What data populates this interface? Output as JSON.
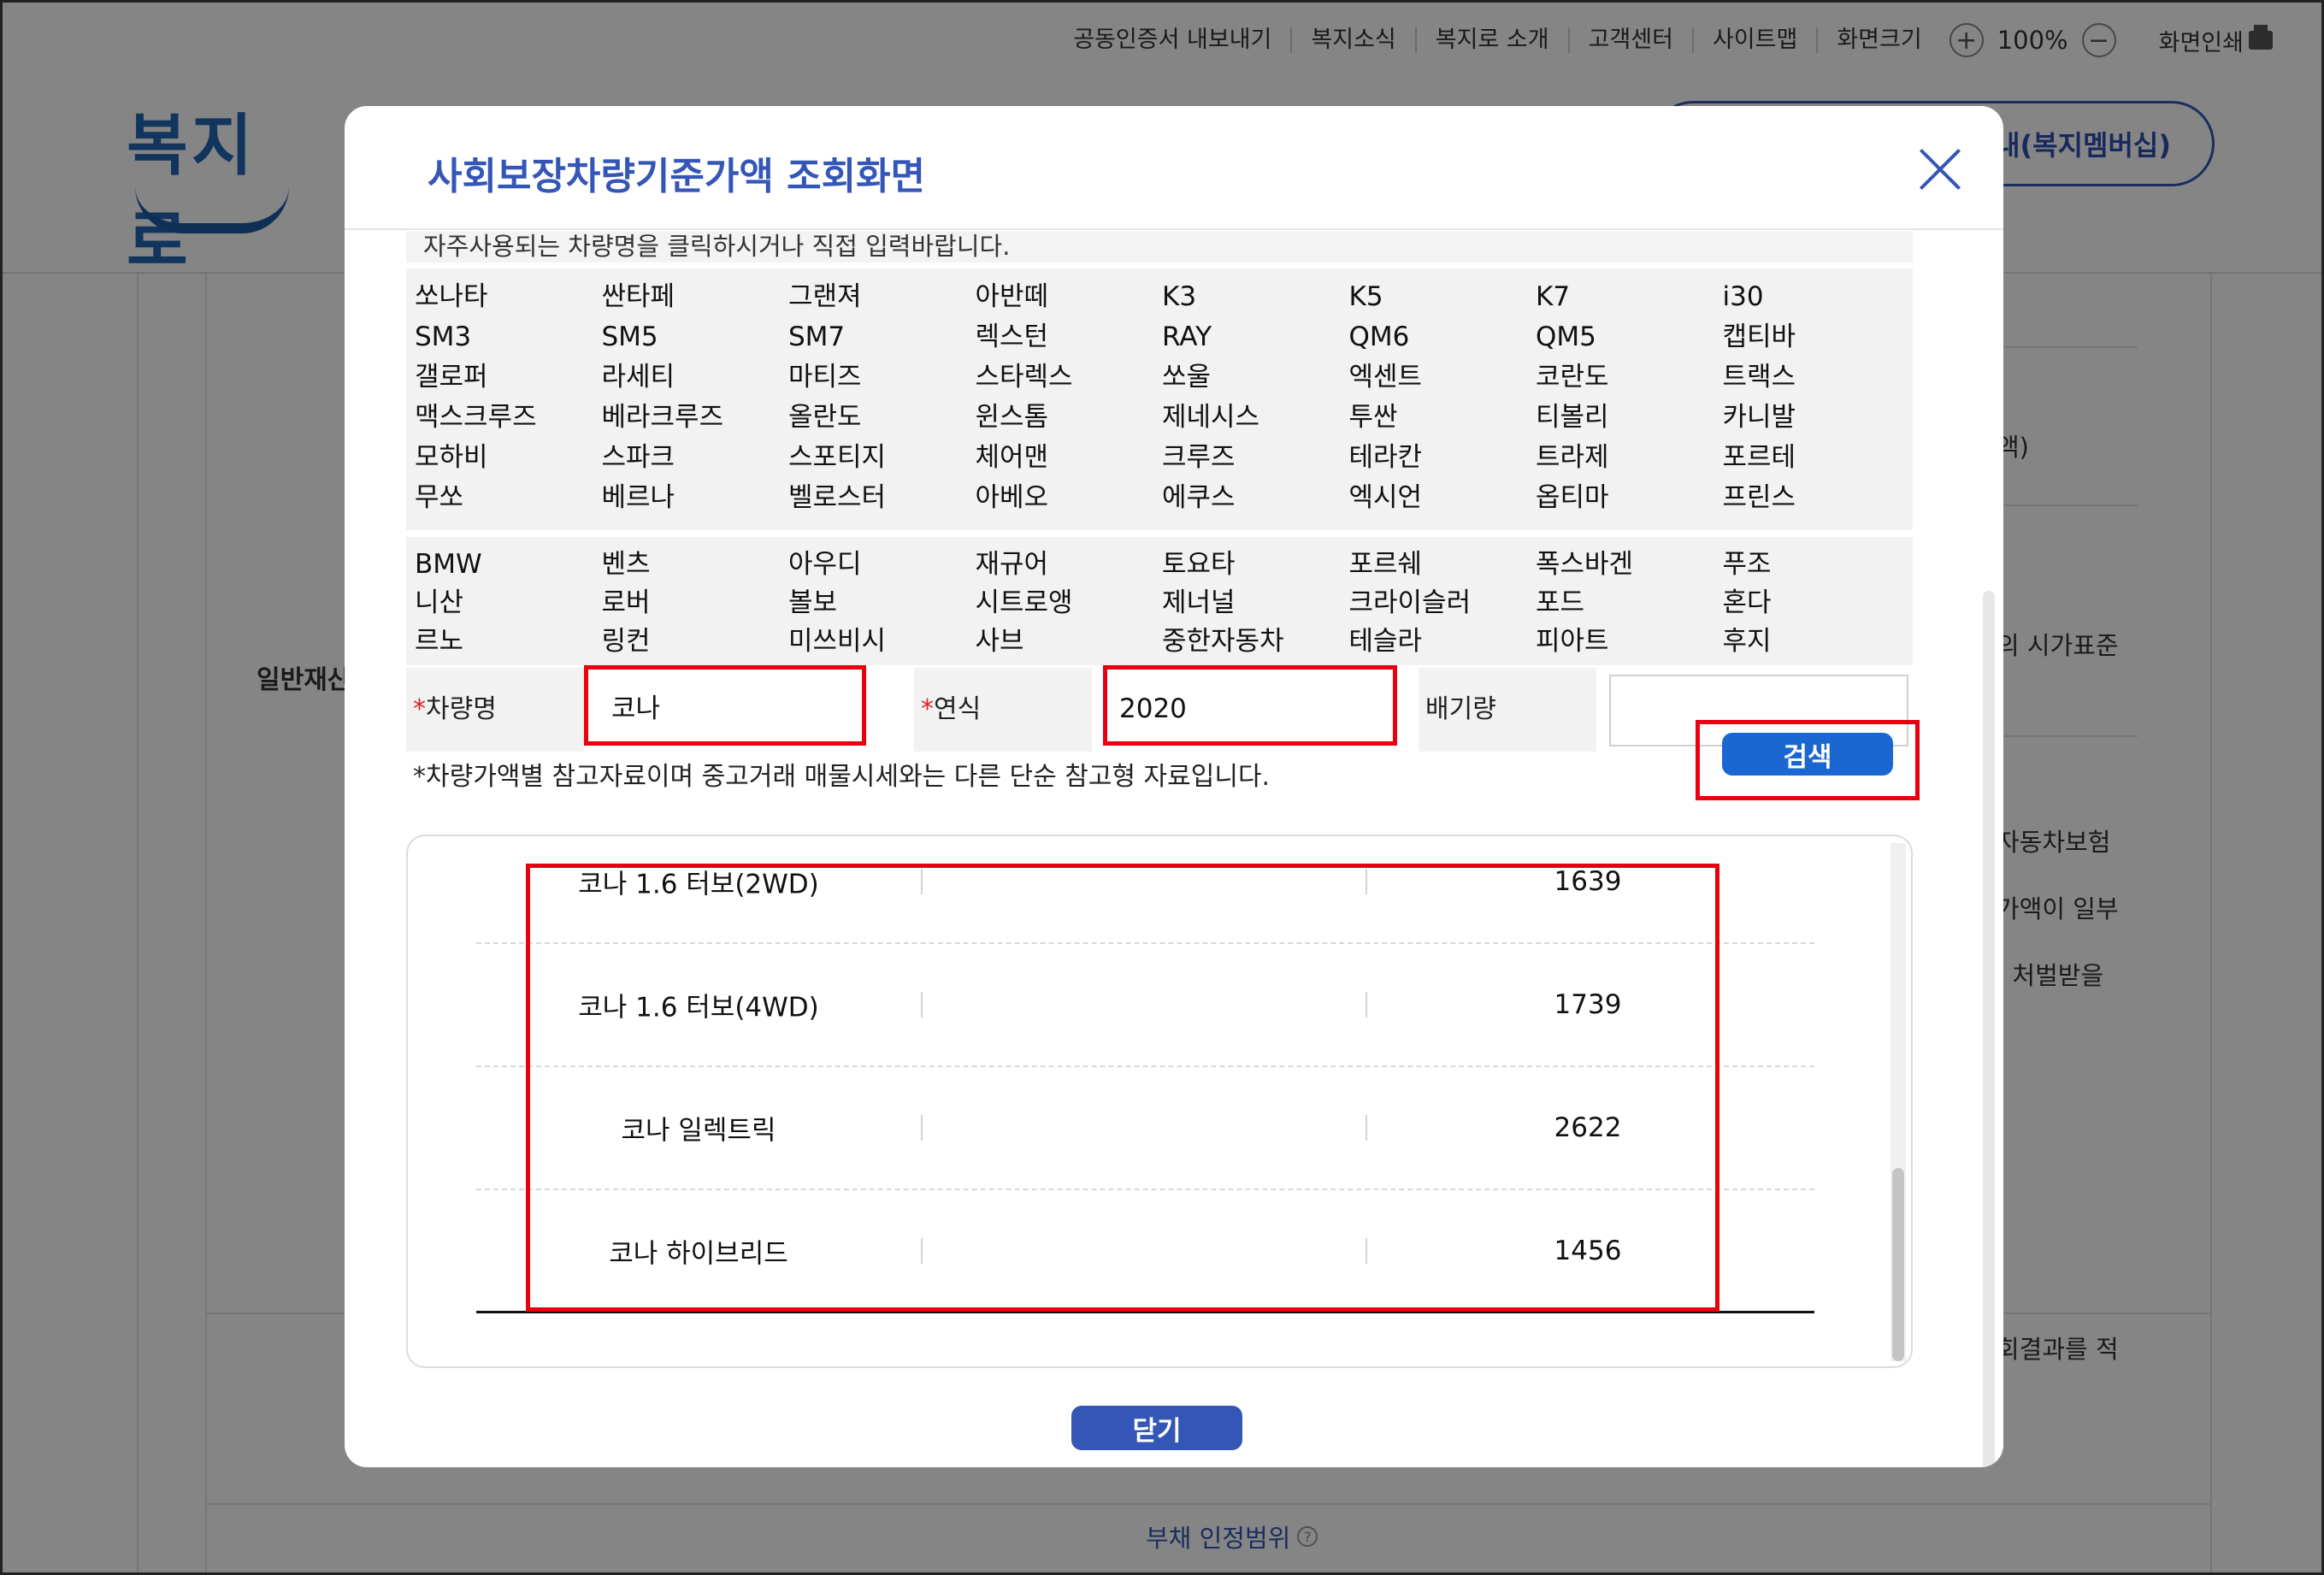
{
  "util_bar": {
    "items": [
      "공동인증서 내보내기",
      "복지소식",
      "복지로 소개",
      "고객센터",
      "사이트맵",
      "화면크기"
    ],
    "zoom_plus": "+",
    "zoom": "100%",
    "zoom_minus": "−",
    "print": "화면인쇄"
  },
  "logo": {
    "text": "복지로"
  },
  "member_button": "내(복지멤버십)",
  "background": {
    "label": "일반재산",
    "right_texts": [
      "액)",
      "의 시가표준",
      "자동차보험",
      "가액이 일부",
      "· 처벌받을",
      "회결과를 적"
    ],
    "bottom_label": "부채 인정범위",
    "bottom_q": "?"
  },
  "modal": {
    "title": "사회보장차량기준가액 조회화면",
    "notice": "자주사용되는 차량명을 클릭하시거나 직접 입력바랍니다.",
    "domestic_cars": [
      "쏘나타",
      "싼타페",
      "그랜져",
      "아반떼",
      "K3",
      "K5",
      "K7",
      "i30",
      "SM3",
      "SM5",
      "SM7",
      "렉스턴",
      "RAY",
      "QM6",
      "QM5",
      "캡티바",
      "갤로퍼",
      "라세티",
      "마티즈",
      "스타렉스",
      "쏘울",
      "엑센트",
      "코란도",
      "트랙스",
      "맥스크루즈",
      "베라크루즈",
      "올란도",
      "윈스톰",
      "제네시스",
      "투싼",
      "티볼리",
      "카니발",
      "모하비",
      "스파크",
      "스포티지",
      "체어맨",
      "크루즈",
      "테라칸",
      "트라제",
      "포르테",
      "무쏘",
      "베르나",
      "벨로스터",
      "아베오",
      "에쿠스",
      "엑시언",
      "옵티마",
      "프린스"
    ],
    "import_cars": [
      "BMW",
      "벤츠",
      "아우디",
      "재규어",
      "토요타",
      "포르쉐",
      "폭스바겐",
      "푸조",
      "니산",
      "로버",
      "볼보",
      "시트로앵",
      "제너널",
      "크라이슬러",
      "포드",
      "혼다",
      "르노",
      "링컨",
      "미쓰비시",
      "사브",
      "중한자동차",
      "테슬라",
      "피아트",
      "후지"
    ],
    "form": {
      "required_mark": "*",
      "car_name_label": "차량명",
      "car_name_value": "코나",
      "year_label": "연식",
      "year_value": "2020",
      "displacement_label": "배기량",
      "displacement_value": ""
    },
    "disclaimer": "*차량가액별 참고자료이며 중고거래 매물시세와는 다른 단순 참고형 자료입니다.",
    "search_button": "검색",
    "results": [
      {
        "name": "코나 1.6 터보(2WD)",
        "price": "1639"
      },
      {
        "name": "코나 1.6 터보(4WD)",
        "price": "1739"
      },
      {
        "name": "코나 일렉트릭",
        "price": "2622"
      },
      {
        "name": "코나 하이브리드",
        "price": "1456"
      }
    ],
    "close_button": "닫기"
  }
}
